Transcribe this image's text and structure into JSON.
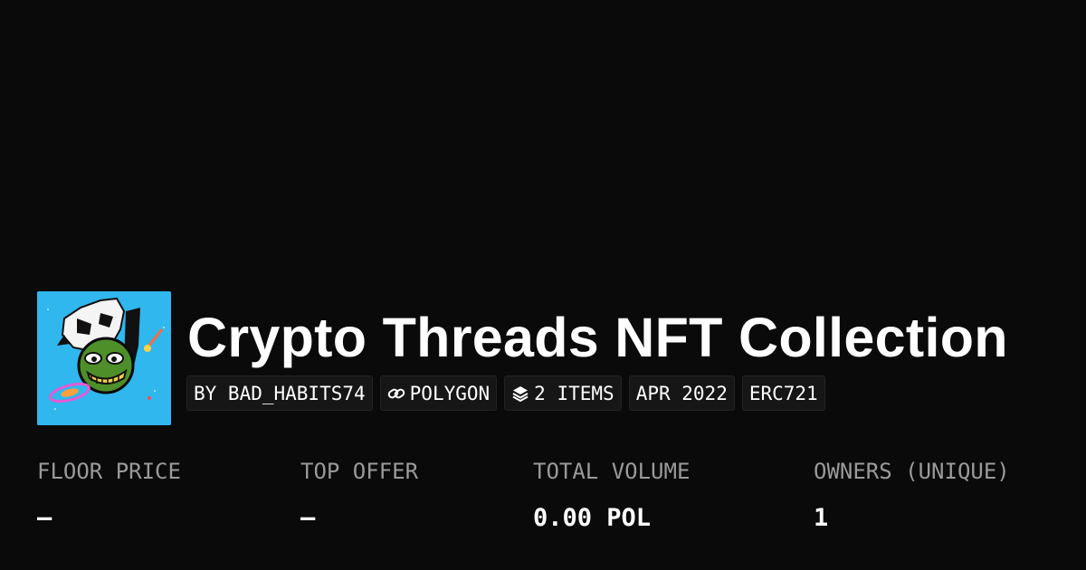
{
  "collection": {
    "title": "Crypto Threads NFT Collection",
    "tags": [
      {
        "label": "BY BAD_HABITS74",
        "icon": ""
      },
      {
        "label": "POLYGON",
        "icon": "link-icon"
      },
      {
        "label": "2 ITEMS",
        "icon": "layers-icon"
      },
      {
        "label": "APR 2022",
        "icon": ""
      },
      {
        "label": "ERC721",
        "icon": ""
      }
    ],
    "avatar_icon": "collection-avatar-icon"
  },
  "stats": [
    {
      "label": "FLOOR PRICE",
      "value": "–"
    },
    {
      "label": "TOP OFFER",
      "value": "–"
    },
    {
      "label": "TOTAL VOLUME",
      "value": "0.00 POL"
    },
    {
      "label": "OWNERS (UNIQUE)",
      "value": "1"
    }
  ],
  "colors": {
    "background": "#0a0a0a",
    "avatar_bg": "#2fb7ee",
    "tag_bg": "#161616",
    "label_gray": "#9a9a9a",
    "text": "#ffffff"
  }
}
